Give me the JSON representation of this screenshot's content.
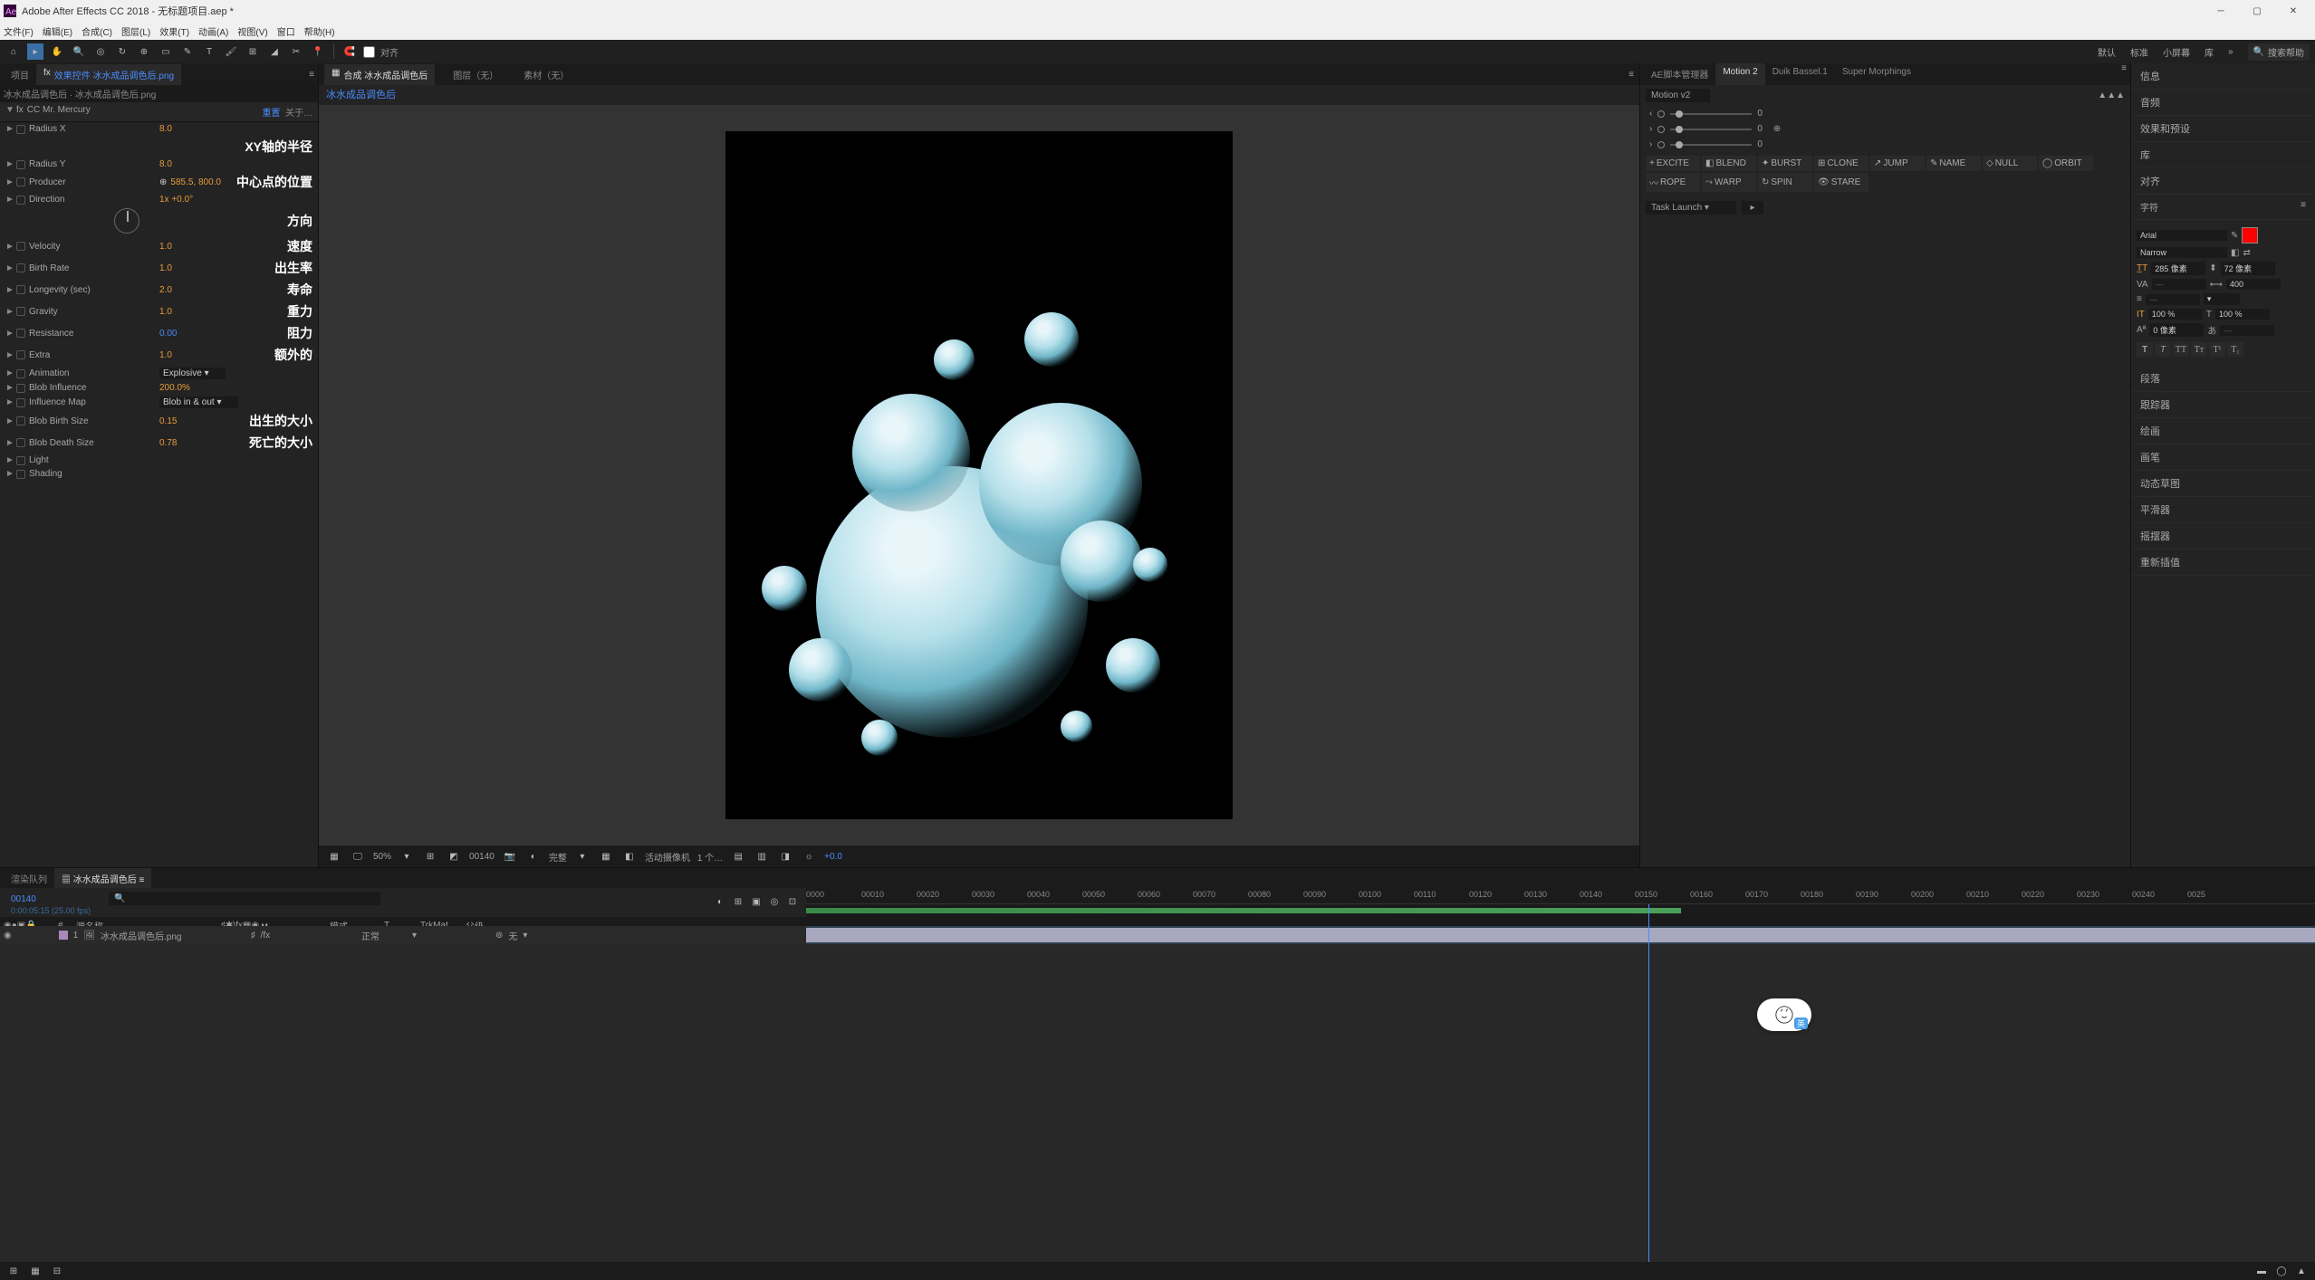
{
  "titlebar": {
    "title": "Adobe After Effects CC 2018 - 无标题项目.aep *"
  },
  "menu": [
    "文件(F)",
    "编辑(E)",
    "合成(C)",
    "图层(L)",
    "效果(T)",
    "动画(A)",
    "视图(V)",
    "窗口",
    "帮助(H)"
  ],
  "toolbar": {
    "snap": "对齐",
    "workspaces": [
      "默认",
      "标准",
      "小屏幕",
      "库"
    ],
    "search_placeholder": "搜索帮助"
  },
  "left": {
    "tab_project": "项目",
    "tab_fx": "效果控件 冰水成品调色后.png",
    "header": "冰水成品调色后 · 冰水成品调色后.png",
    "fx_name": "CC Mr. Mercury",
    "reset": "重置",
    "about": "关于…",
    "annotations": {
      "xy": "XY轴的半径",
      "center": "中心点的位置",
      "dir": "方向",
      "vel": "速度",
      "birth": "出生率",
      "life": "寿命",
      "grav": "重力",
      "res": "阻力",
      "extra": "额外的",
      "bbirth": "出生的大小",
      "bdeath": "死亡的大小"
    },
    "props": [
      {
        "label": "Radius X",
        "val": "8.0"
      },
      {
        "label": "Radius Y",
        "val": "8.0"
      },
      {
        "label": "Producer",
        "val": "585.5, 800.0",
        "icon": "target"
      },
      {
        "label": "Direction",
        "val": "1x +0.0°"
      },
      {
        "label": "Velocity",
        "val": "1.0"
      },
      {
        "label": "Birth Rate",
        "val": "1.0"
      },
      {
        "label": "Longevity (sec)",
        "val": "2.0"
      },
      {
        "label": "Gravity",
        "val": "1.0"
      },
      {
        "label": "Resistance",
        "val": "0.00"
      },
      {
        "label": "Extra",
        "val": "1.0"
      },
      {
        "label": "Animation",
        "val": "Explosive",
        "dd": true
      },
      {
        "label": "Blob Influence",
        "val": "200.0%"
      },
      {
        "label": "Influence Map",
        "val": "Blob in & out",
        "dd": true
      },
      {
        "label": "Blob Birth Size",
        "val": "0.15"
      },
      {
        "label": "Blob Death Size",
        "val": "0.78"
      },
      {
        "label": "Light",
        "val": ""
      },
      {
        "label": "Shading",
        "val": ""
      }
    ]
  },
  "center": {
    "tab_layer": "图层（无）",
    "tab_comp": "合成 冰水成品调色后",
    "tab_footage": "素材（无）",
    "sub": "冰水成品调色后",
    "footer": {
      "zoom": "50%",
      "frame": "00140",
      "full": "完整",
      "cam": "活动摄像机",
      "views": "1 个…",
      "zoom2": "+0.0"
    }
  },
  "scripts": {
    "tabs": [
      "AE脚本管理器",
      "Motion 2",
      "Duik Bassel.1",
      "Super Morphings"
    ],
    "preset": "Motion v2",
    "sliders": [
      "0",
      "0",
      "0"
    ],
    "buttons": [
      "EXCITE",
      "BLEND",
      "BURST",
      "CLONE",
      "JUMP",
      "NAME",
      "NULL",
      "ORBIT",
      "ROPE",
      "WARP",
      "SPIN",
      "STARE"
    ],
    "task": "Task Launch"
  },
  "farright": {
    "tabs": [
      "信息",
      "音频",
      "效果和预设",
      "库",
      "对齐",
      "字符",
      "段落",
      "跟踪器",
      "绘画",
      "画笔",
      "动态草图",
      "平滑器",
      "摇摆器",
      "重新插值"
    ],
    "font": "Arial",
    "style": "Narrow",
    "size": "285 像素",
    "leading": "72 像素",
    "tracking": "400",
    "vsc": "100 %",
    "hsc": "100 %",
    "baseline": "0 像素",
    "fill_label": "填充"
  },
  "timeline": {
    "tab_rq": "渲染队列",
    "tab_comp": "冰水成品调色后",
    "timecode": "00140",
    "subtc": "0:00:05:15 (25.00 fps)",
    "cols": {
      "src": "源名称",
      "mode": "模式",
      "trk": "TrkMat",
      "parent": "父级",
      "av": "♯●◉⇄"
    },
    "layer": {
      "num": "1",
      "name": "冰水成品调色后.png",
      "mode": "正常",
      "parent": "无"
    },
    "ticks": [
      "0000",
      "00010",
      "00020",
      "00030",
      "00040",
      "00050",
      "00060",
      "00070",
      "00080",
      "00090",
      "00100",
      "00110",
      "00120",
      "00130",
      "00140",
      "00150",
      "00160",
      "00170",
      "00180",
      "00190",
      "00200",
      "00210",
      "00220",
      "00230",
      "00240",
      "0025"
    ]
  }
}
